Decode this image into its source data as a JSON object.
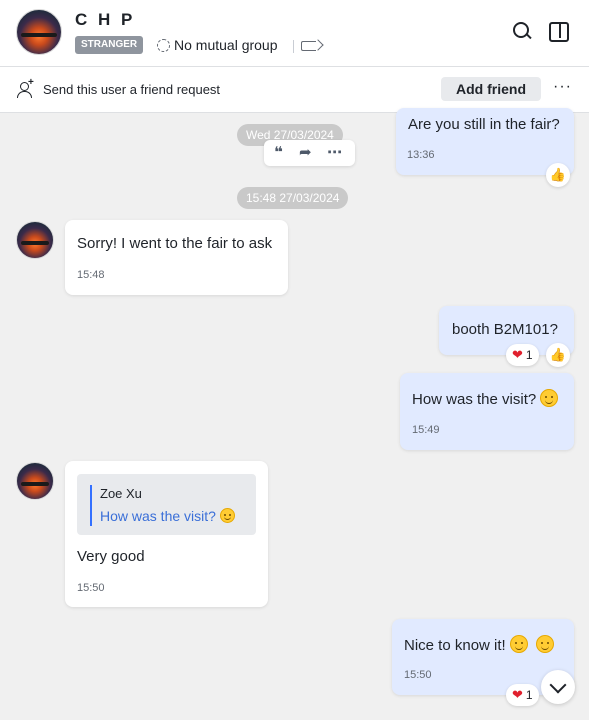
{
  "header": {
    "name": "C H P",
    "badge": "STRANGER",
    "mutual_group": "No mutual group",
    "icons": [
      "search-icon",
      "side-panel-icon",
      "tag-icon",
      "group-icon"
    ]
  },
  "friend_request_bar": {
    "text": "Send this user a friend request",
    "add_button": "Add friend",
    "more": "···"
  },
  "messages": [
    {
      "side": "out",
      "text": "Are you still in the fair?",
      "time": "13:36",
      "reaction": "thumbs-up-icon"
    },
    {
      "side": "in",
      "text": "Sorry! I went to the fair to ask",
      "time": "15:48"
    },
    {
      "side": "out",
      "text": "booth B2M101?",
      "reaction_count": "1",
      "reaction": "heart-icon"
    },
    {
      "side": "out",
      "text": "How was the visit?",
      "emoji": "smile-emoji",
      "time": "15:49"
    },
    {
      "side": "in",
      "quote_author": "Zoe Xu",
      "quote_text": "How was the visit?",
      "text": "Very good",
      "time": "15:50"
    },
    {
      "side": "out",
      "text": "Nice to know it!",
      "emoji": "smile-emoji x2",
      "time": "15:50",
      "reaction_count": "1"
    }
  ],
  "date_chips": [
    "Wed 27/03/2024",
    "15:48 27/03/2024"
  ],
  "hover_actions": [
    "quote-icon",
    "forward-icon",
    "more-icon"
  ],
  "colors": {
    "outgoing_bubble": "#e1eaff",
    "incoming_bubble": "#ffffff",
    "background": "#f0f0f0",
    "accent": "#3370ff"
  }
}
